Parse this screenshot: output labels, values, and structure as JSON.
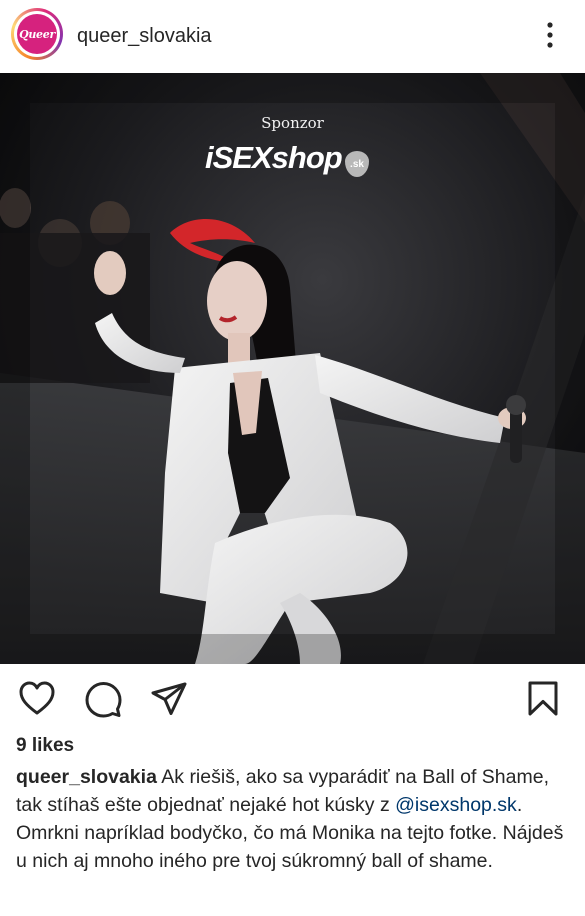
{
  "post": {
    "username": "queer_slovakia",
    "avatar_text": "Queer",
    "more_icon": "more-vertical-icon",
    "photo": {
      "sponsor_label": "Sponzor",
      "brand": "iSEXshop",
      "brand_suffix": ".sk"
    },
    "actions": {
      "like_icon": "heart-icon",
      "comment_icon": "comment-icon",
      "share_icon": "send-icon",
      "save_icon": "bookmark-icon"
    },
    "likes_text": "9 likes",
    "caption": {
      "username": "queer_slovakia",
      "text_before": " Ak riešiš, ako sa vyparádiť na Ball of Shame, tak stíhaš ešte objednať nejaké hot kúsky z ",
      "mention": "@isexshop.sk",
      "text_after": ". Omrkni napríklad bodyčko, čo má Monika na tejto fotke. Nájdeš u nich aj mnoho iného pre tvoj súkromný ball of shame."
    },
    "colors": {
      "avatar_brand": "#d6227e",
      "mention": "#00376b",
      "text": "#262626"
    }
  }
}
